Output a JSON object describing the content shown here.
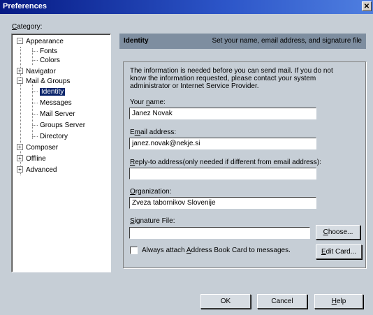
{
  "window": {
    "title": "Preferences",
    "close_glyph": "✕"
  },
  "category": {
    "label_first": "C",
    "label_rest": "ategory:"
  },
  "tree": {
    "expand_glyph": "−",
    "collapse_glyph": "+",
    "items": [
      {
        "label": "Appearance"
      },
      {
        "label": "Fonts"
      },
      {
        "label": "Colors"
      },
      {
        "label": "Navigator"
      },
      {
        "label": "Mail & Groups"
      },
      {
        "label": "Identity"
      },
      {
        "label": "Messages"
      },
      {
        "label": "Mail Server"
      },
      {
        "label": "Groups Server"
      },
      {
        "label": "Directory"
      },
      {
        "label": "Composer"
      },
      {
        "label": "Offline"
      },
      {
        "label": "Advanced"
      }
    ]
  },
  "panel": {
    "title": "Identity",
    "description": "Set your name, email address, and signature file",
    "info_line1": "The information is needed before you can send mail.  If you do not",
    "info_line2": "know the information requested, please contact your system",
    "info_line3": "administrator or Internet Service Provider."
  },
  "fields": {
    "name_label_a": "Your ",
    "name_label_u": "n",
    "name_label_b": "ame:",
    "name_value": "Janez Novak",
    "email_label_a": "E",
    "email_label_u": "m",
    "email_label_b": "ail address:",
    "email_value": "janez.novak@nekje.si",
    "reply_label_u": "R",
    "reply_label_b": "eply-to address(only needed if different from email address):",
    "reply_value": "",
    "org_label_u": "O",
    "org_label_b": "rganization:",
    "org_value": "Zveza tabornikov Slovenije",
    "sig_label_u": "S",
    "sig_label_b": "ignature File:",
    "sig_value": ""
  },
  "buttons": {
    "choose_u": "C",
    "choose_b": "hoose...",
    "edit_card_u": "E",
    "edit_card_b": "dit Card...",
    "ok": "OK",
    "cancel": "Cancel",
    "help_u": "H",
    "help_b": "elp"
  },
  "checkbox": {
    "label_a": "Always attach ",
    "label_u": "A",
    "label_b": "ddress Book Card to messages.",
    "checked": false
  },
  "colors": {
    "title_bar": "#061a84",
    "panel_header": "#7e8ea0",
    "selection": "#0a246a",
    "dialog_bg": "#c6ced6"
  }
}
